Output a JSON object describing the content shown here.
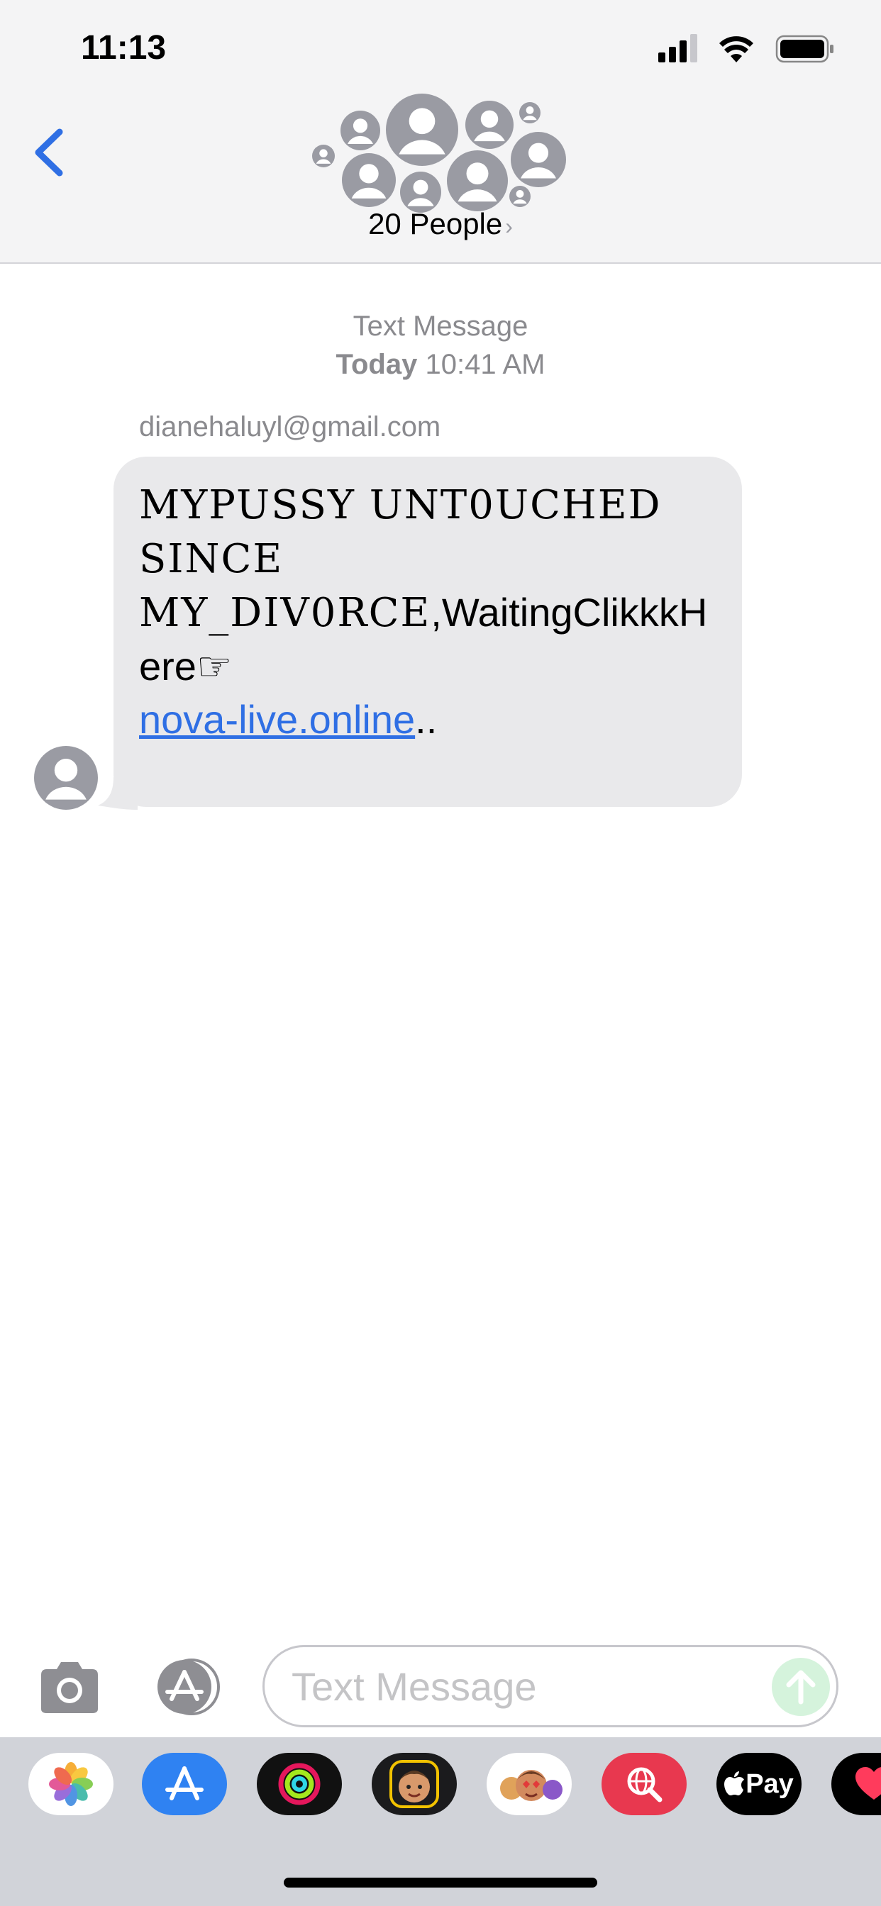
{
  "status_bar": {
    "time": "11:13"
  },
  "header": {
    "group_title": "20 People",
    "chevron": "›"
  },
  "conversation": {
    "service_label": "Text Message",
    "date_prefix": "Today",
    "time": "10:41 AM",
    "sender": "dianehaluyl@gmail.com",
    "message": {
      "line1": "MYPUSSY UNT0UCHED",
      "line2": "SINCE",
      "line3_outline": "MY_DIV0RCE",
      "line3_rest": ",WaitingClikkkH",
      "line4": "ere☞",
      "link": "nova-live.online",
      "trailing": ".."
    }
  },
  "composer": {
    "placeholder": "Text Message"
  },
  "app_drawer": {
    "apple_pay_label": "Pay"
  },
  "colors": {
    "accent_blue": "#2f6fe4",
    "bubble_gray": "#e9e9eb",
    "avatar_gray": "#9a9ba3",
    "send_green_disabled": "#d5f3dc"
  }
}
